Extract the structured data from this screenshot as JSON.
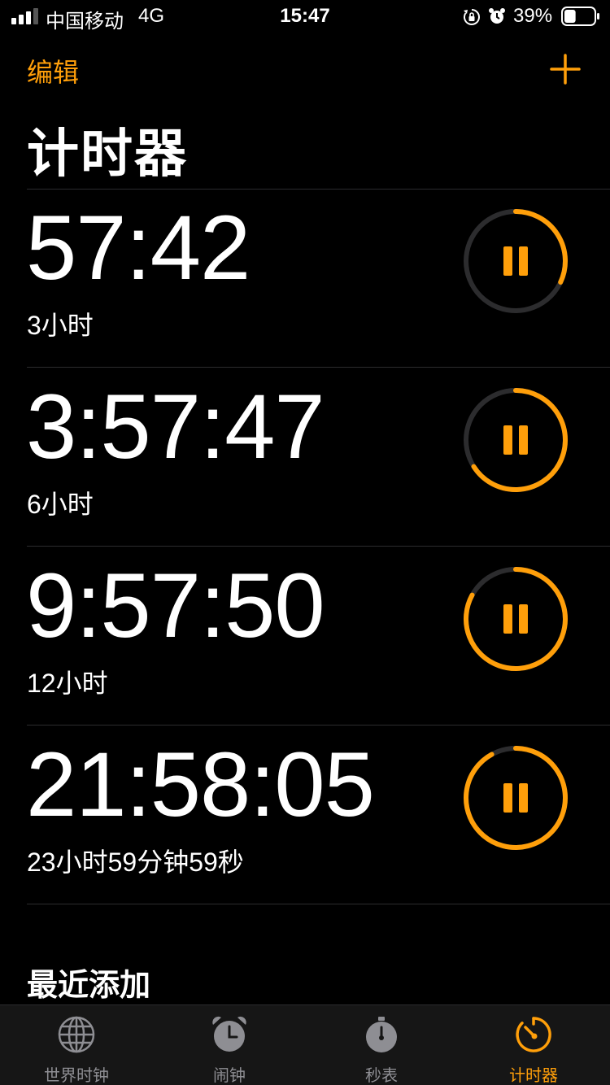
{
  "status_bar": {
    "carrier": "中国移动",
    "network": "4G",
    "time": "15:47",
    "battery_percent": "39%",
    "signal_bars_active": 3,
    "signal_bars_total": 4,
    "battery_level": 0.39,
    "icons": [
      "signal-icon",
      "orientation-lock-icon",
      "alarm-icon",
      "battery-icon"
    ]
  },
  "nav": {
    "edit_label": "编辑",
    "add_icon": "plus-icon",
    "title": "计时器"
  },
  "timers": [
    {
      "remaining": "57:42",
      "label": "3小时",
      "progress_remaining": 0.32,
      "control_icon": "pause-icon"
    },
    {
      "remaining": "3:57:47",
      "label": "6小时",
      "progress_remaining": 0.66,
      "control_icon": "pause-icon"
    },
    {
      "remaining": "9:57:50",
      "label": "12小时",
      "progress_remaining": 0.83,
      "control_icon": "pause-icon"
    },
    {
      "remaining": "21:58:05",
      "label": "23小时59分钟59秒",
      "progress_remaining": 0.92,
      "control_icon": "pause-icon"
    }
  ],
  "recent": {
    "title": "最近添加"
  },
  "tab_bar": {
    "tabs": [
      {
        "label": "世界时钟",
        "icon": "globe-icon",
        "active": false
      },
      {
        "label": "闹钟",
        "icon": "alarm-clock-icon",
        "active": false
      },
      {
        "label": "秒表",
        "icon": "stopwatch-icon",
        "active": false
      },
      {
        "label": "计时器",
        "icon": "timer-icon",
        "active": true
      }
    ]
  },
  "colors": {
    "accent": "#ff9f0a",
    "background": "#000000",
    "ring_track": "#2c2c2e",
    "inactive_tab": "#8e8e93"
  }
}
